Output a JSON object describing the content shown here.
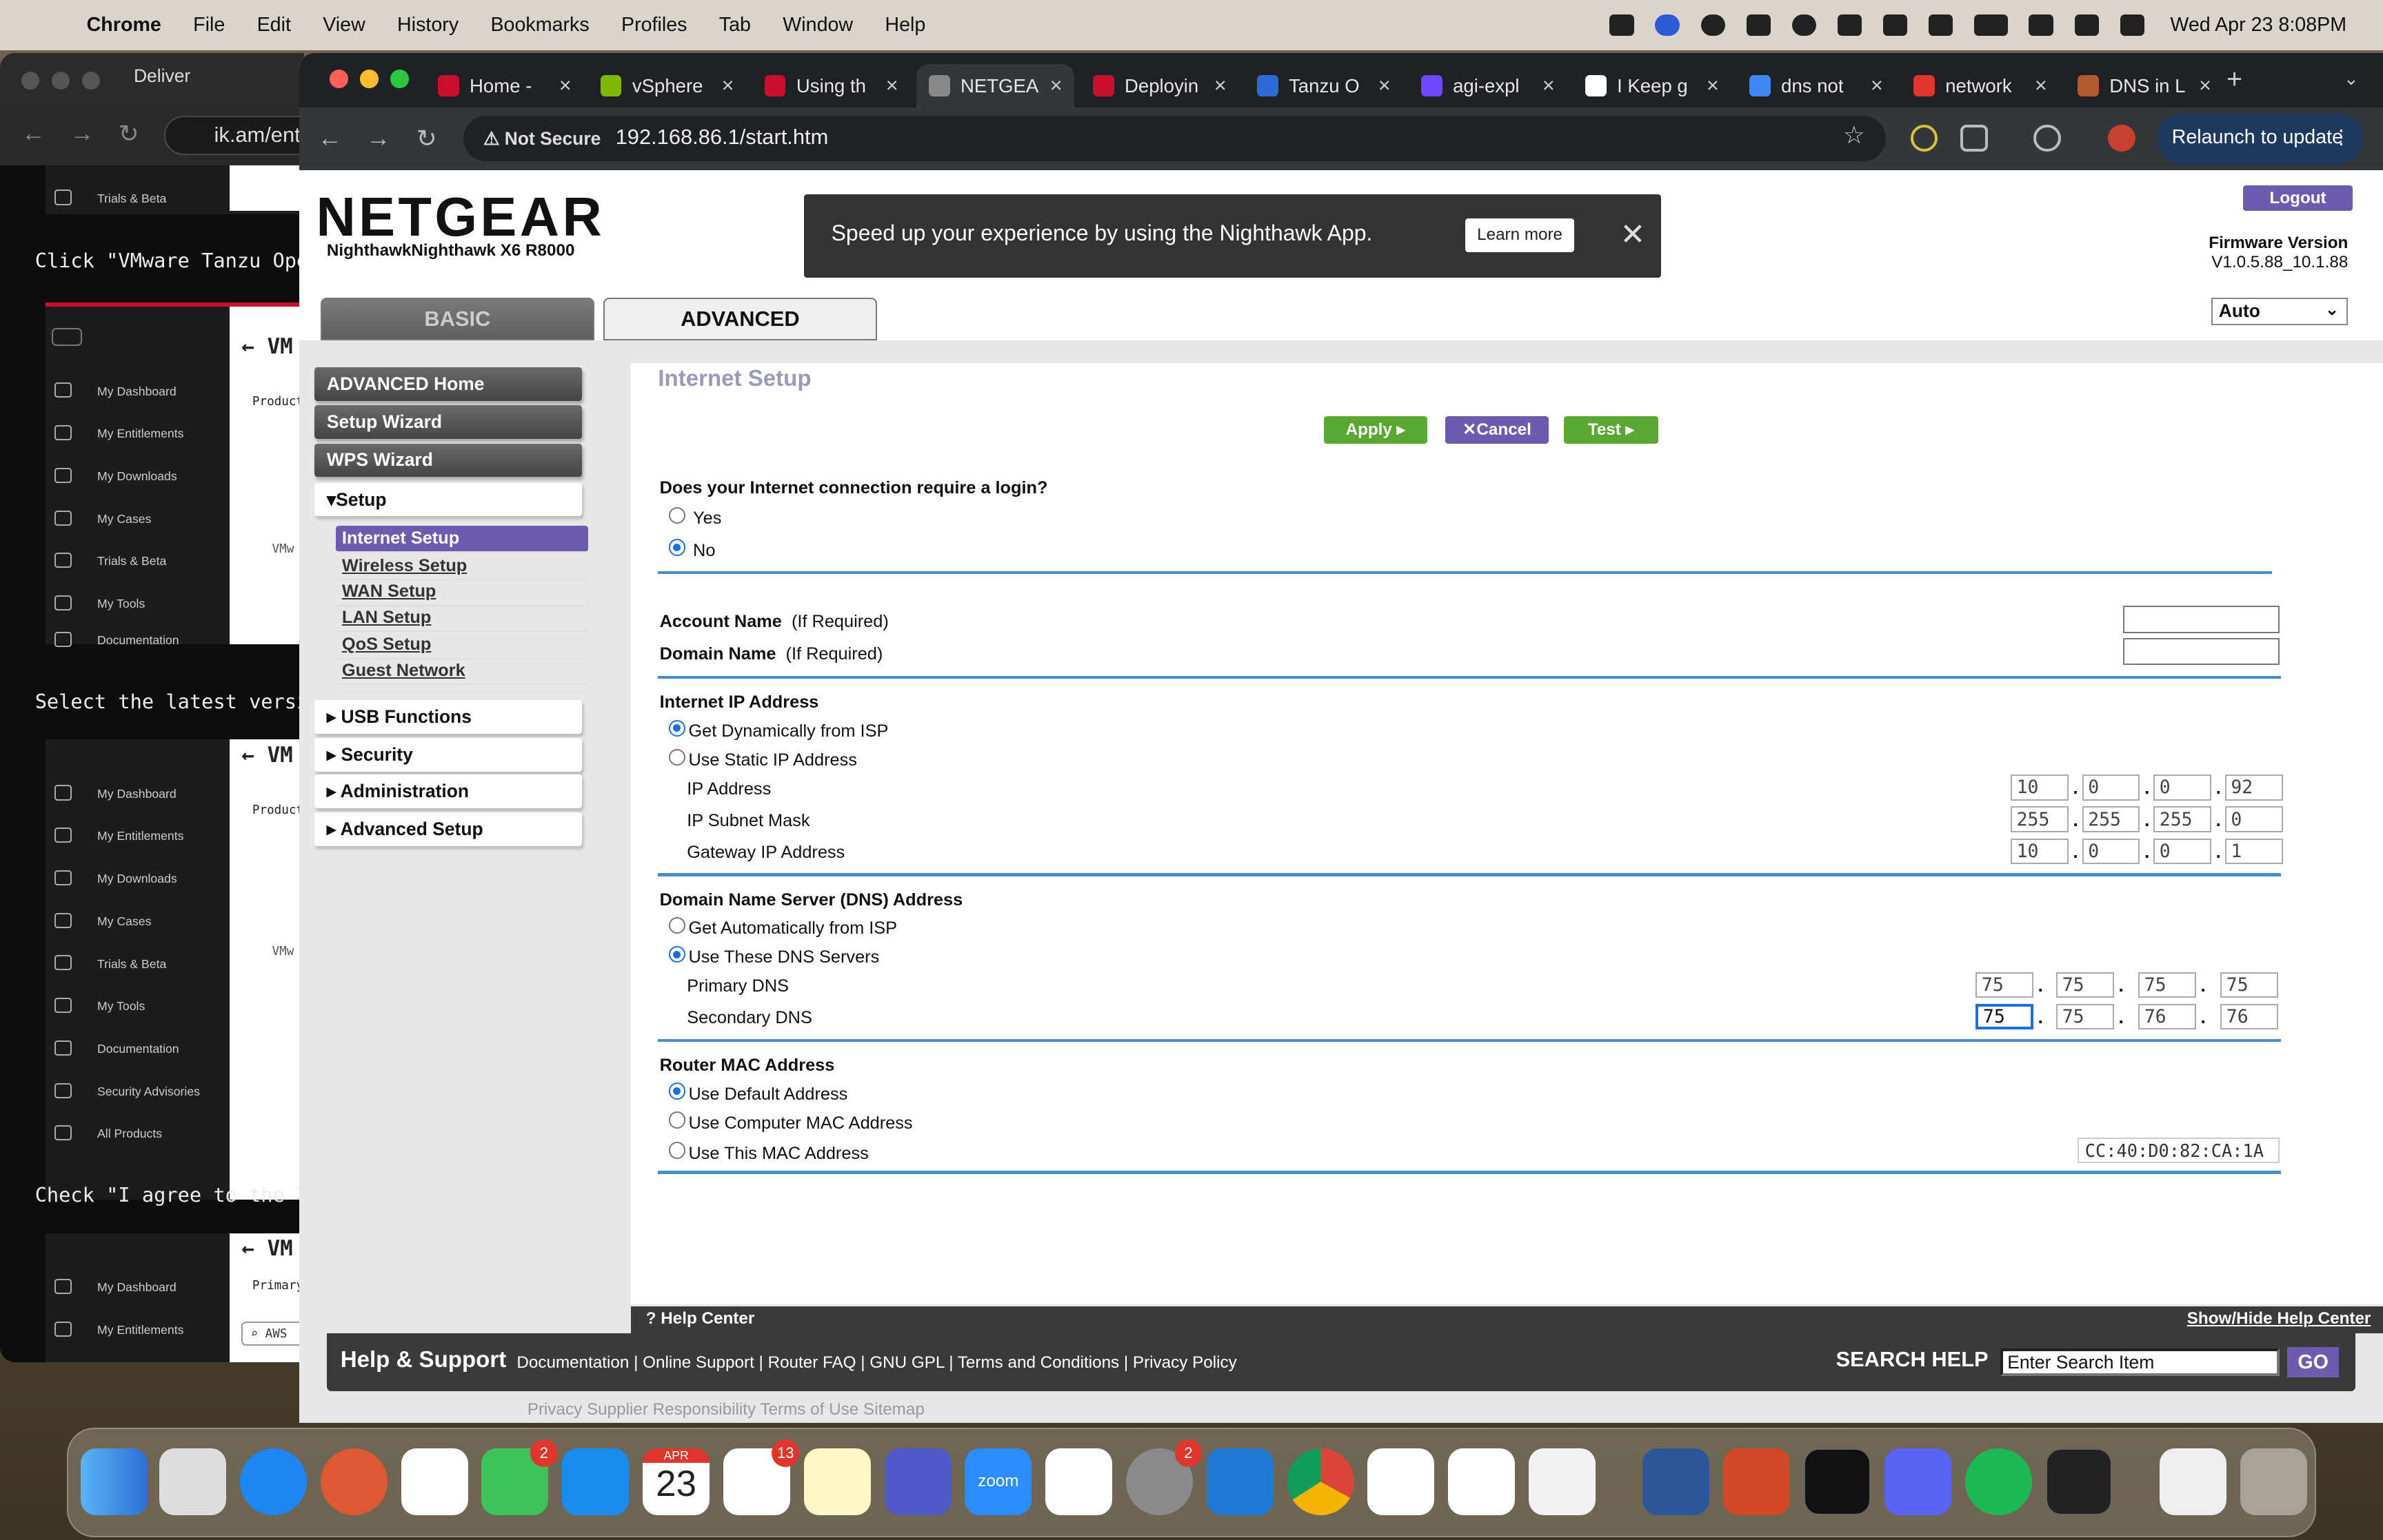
{
  "menubar": {
    "app": "Chrome",
    "menus": [
      "File",
      "Edit",
      "View",
      "History",
      "Bookmarks",
      "Profiles",
      "Tab",
      "Window",
      "Help"
    ],
    "clock": "Wed Apr 23  8:08PM"
  },
  "bg_window": {
    "tab_label": "Deliver",
    "url": "ik.am/ent",
    "texts": [
      "Click \"VMware Tanzu Opera",
      "Select the latest version",
      "Check \"I agree to the Ter"
    ],
    "nav_items_1": [
      "Trials & Beta"
    ],
    "nav_items_2": [
      "My Dashboard",
      "My Entitlements",
      "My Downloads",
      "My Cases",
      "Trials & Beta",
      "My Tools",
      "Documentation"
    ],
    "nav_items_3": [
      "My Dashboard",
      "My Entitlements",
      "My Downloads",
      "My Cases",
      "Trials & Beta",
      "My Tools",
      "Documentation",
      "Security Advisories",
      "All Products"
    ],
    "nav_items_4": [
      "My Dashboard",
      "My Entitlements"
    ],
    "panel_heading": "VM",
    "product_label": "Product",
    "vm_label": "VMw",
    "primary_label": "Primary",
    "aws_label": "AWS"
  },
  "tabs": [
    {
      "label": "Home - ",
      "color": "#c8102e"
    },
    {
      "label": "vSphere",
      "color": "#7fb800"
    },
    {
      "label": "Using th",
      "color": "#c8102e"
    },
    {
      "label": "NETGEA",
      "color": "#888888",
      "active": true
    },
    {
      "label": "Deployin",
      "color": "#c8102e"
    },
    {
      "label": "Tanzu O",
      "color": "#2f6bd6"
    },
    {
      "label": "agi-expl",
      "color": "#6c47ff"
    },
    {
      "label": "I Keep g",
      "color": "#ffffff"
    },
    {
      "label": "dns not",
      "color": "#4285f4"
    },
    {
      "label": "network",
      "color": "#e0352b"
    },
    {
      "label": "DNS in L",
      "color": "#b05a30"
    }
  ],
  "omnibox": {
    "security": "Not Secure",
    "url": "192.168.86.1/start.htm"
  },
  "relaunch": "Relaunch to update",
  "router": {
    "logo": "NETGEAR",
    "model": "NighthawkNighthawk X6 R8000",
    "promo": "Speed up your experience by using the Nighthawk App.",
    "learn_more": "Learn more",
    "logout": "Logout",
    "fw_title": "Firmware Version",
    "fw_version": "V1.0.5.88_10.1.88",
    "lang": "Auto",
    "tab_basic": "BASIC",
    "tab_advanced": "ADVANCED"
  },
  "sidemenu": {
    "advanced_home": "ADVANCED Home",
    "setup_wizard": "Setup Wizard",
    "wps_wizard": "WPS Wizard",
    "setup": "▾Setup",
    "sub": [
      "Internet Setup",
      "Wireless Setup",
      "WAN Setup",
      "LAN Setup",
      "QoS Setup",
      "Guest Network"
    ],
    "usb": "▸ USB Functions",
    "security": "▸ Security",
    "administration": "▸ Administration",
    "advanced_setup": "▸ Advanced Setup"
  },
  "form": {
    "title": "Internet Setup",
    "apply": "Apply ▸",
    "cancel": "Cancel",
    "test": "Test ▸",
    "login_q": "Does your Internet connection require a login?",
    "yes": "Yes",
    "no": "No",
    "account_name": "Account Name",
    "domain_name": "Domain Name",
    "if_required": "(If Required)",
    "ip_header": "Internet IP Address",
    "get_dyn": "Get Dynamically from ISP",
    "use_static": "Use Static IP Address",
    "ip_address": "IP Address",
    "subnet": "IP Subnet Mask",
    "gateway": "Gateway IP Address",
    "ip_vals": [
      "10",
      "0",
      "0",
      "92"
    ],
    "mask_vals": [
      "255",
      "255",
      "255",
      "0"
    ],
    "gw_vals": [
      "10",
      "0",
      "0",
      "1"
    ],
    "dns_header": "Domain Name Server (DNS) Address",
    "dns_auto": "Get Automatically from ISP",
    "dns_use": "Use These DNS Servers",
    "primary_dns": "Primary DNS",
    "secondary_dns": "Secondary DNS",
    "pdns_vals": [
      "75",
      "75",
      "75",
      "75"
    ],
    "sdns_vals": [
      "75",
      "75",
      "76",
      "76"
    ],
    "mac_header": "Router MAC Address",
    "mac_default": "Use Default Address",
    "mac_computer": "Use Computer MAC Address",
    "mac_this": "Use This MAC Address",
    "mac_value": "CC:40:D0:82:CA:1A"
  },
  "help": {
    "center": "Help Center",
    "toggle": "Show/Hide Help Center",
    "support": "Help & Support",
    "links": "Documentation | Online Support | Router FAQ | GNU GPL | Terms and Conditions | Privacy Policy",
    "search_label": "SEARCH HELP",
    "search_placeholder": "Enter Search Item",
    "go": "GO",
    "below": "Privacy   Supplier Responsibility   Terms of Use   Sitemap"
  },
  "dock": {
    "calendar_month": "APR",
    "calendar_day": "23",
    "facetime_badge": "2",
    "reminders_badge": "13",
    "settings_badge": "2",
    "zoom_label": "zoom"
  }
}
